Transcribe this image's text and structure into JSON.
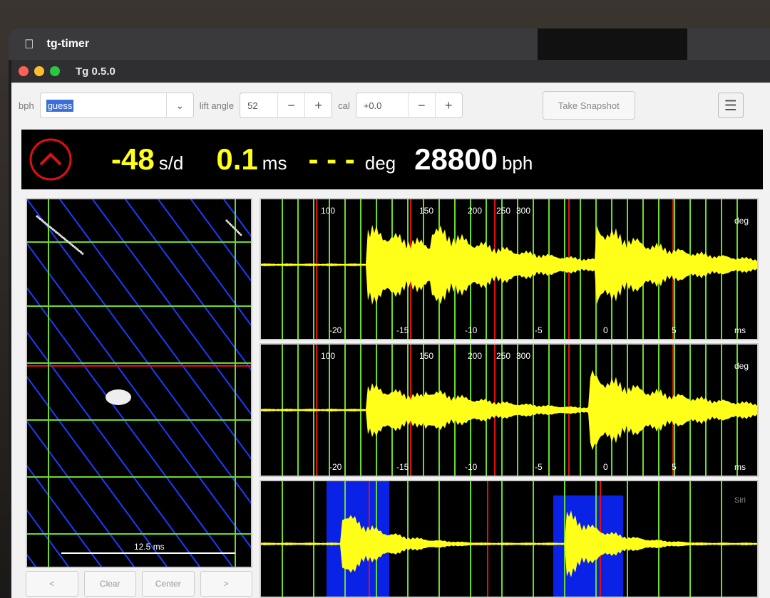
{
  "menubar": {
    "app_name": "tg-timer",
    "apple_icon": "apple-icon"
  },
  "window": {
    "title": "Tg 0.5.0"
  },
  "toolbar": {
    "bph_label": "bph",
    "bph_value": "guess",
    "lift_angle_label": "lift angle",
    "lift_angle_value": "52",
    "cal_label": "cal",
    "cal_value": "+0.0",
    "minus": "−",
    "plus": "+",
    "snapshot_label": "Take Snapshot",
    "menu_icon": "hamburger-icon"
  },
  "readout": {
    "rate_value": "-48",
    "rate_unit": "s/d",
    "beat_error_value": "0.1",
    "beat_error_unit": "ms",
    "amplitude_value": "- - -",
    "amplitude_unit": "deg",
    "bph_value": "28800",
    "bph_unit": "bph",
    "status_icon": "signal-status-icon",
    "status_color": "#e01010"
  },
  "paperstrip": {
    "scale_label": "12.5 ms",
    "buttons": [
      "<",
      "Clear",
      "Center",
      ">"
    ]
  },
  "traces": {
    "deg_ticks": [
      "100",
      "150",
      "200",
      "250",
      "300"
    ],
    "ms_ticks": [
      "-20",
      "-15",
      "-10",
      "-5",
      "0",
      "5"
    ],
    "deg_unit": "deg",
    "ms_unit": "ms",
    "siri_label": "Siri"
  },
  "colors": {
    "waveform": "#ffff1a",
    "grid_green": "#6bdc2a",
    "grid_red": "#e01010",
    "highlight_blue": "#0a22e6",
    "strip_diagonal": "#1a3cff"
  }
}
